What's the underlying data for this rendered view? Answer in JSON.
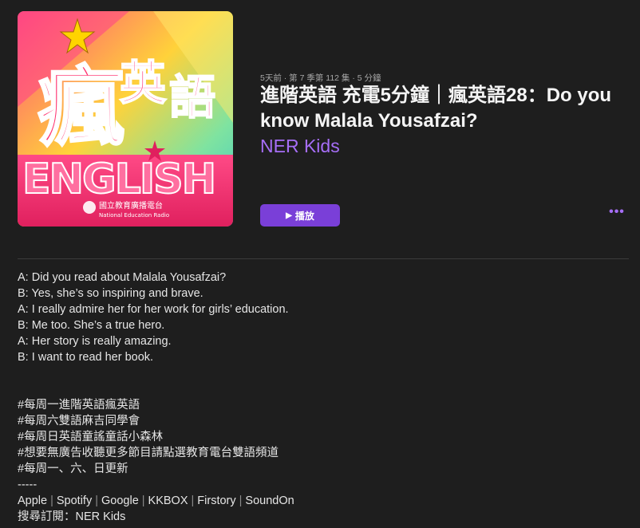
{
  "artwork": {
    "alt_text": "瘋英語 ENGLISH",
    "logo_chinese": "國立教育廣播電台",
    "logo_english": "National Education Radio"
  },
  "episode": {
    "meta": "5天前 · 第 7 季第 112 集 · 5 分鐘",
    "title": "進階英語 充電5分鐘｜瘋英語28：Do you know Malala Yousafzai?",
    "show": "NER Kids"
  },
  "actions": {
    "play_icon": "▶",
    "play_label": "播放",
    "more_label": "•••"
  },
  "description": {
    "dialogue": [
      "A: Did you read about Malala Yousafzai?",
      "B: Yes, she’s so inspiring and brave.",
      "A: I really admire her for her work for girls’ education.",
      "B: Me too. She’s a true hero.",
      "A: Her story is really amazing.",
      "B: I want to read her book."
    ],
    "hashtags": [
      "#每周一進階英語瘋英語",
      "#每周六雙語麻吉同學會",
      "#每周日英語童謠童話小森林",
      "#想要無廣告收聽更多節目請點選教育電台雙語頻道",
      "#每周一、六、日更新"
    ],
    "dashes": "-----",
    "platforms": [
      "Apple",
      "Spotify",
      "Google",
      "KKBOX",
      "Firstory",
      "SoundOn"
    ],
    "platform_separator": "|",
    "subscribe": "搜尋訂閱：NER Kids"
  },
  "colors": {
    "background": "#1e1e1e",
    "accent": "#a66ef7",
    "play_button": "#7a3fd8"
  }
}
